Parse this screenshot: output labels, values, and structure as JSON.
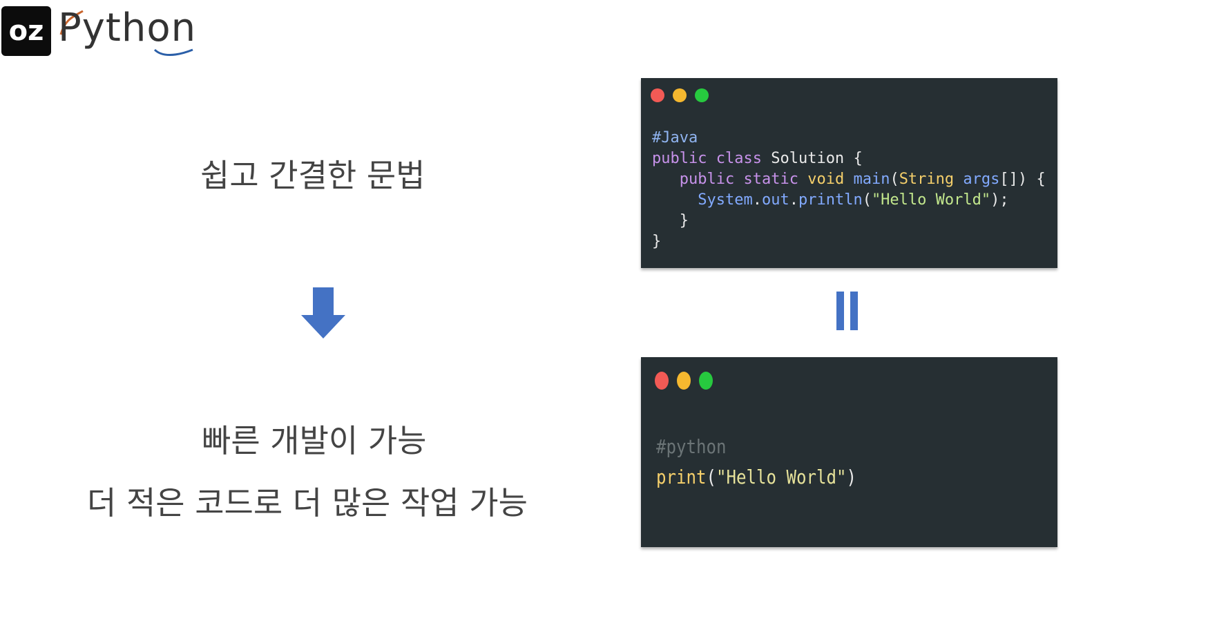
{
  "logo": {
    "badge": "oz",
    "word": "Python"
  },
  "headings": {
    "line1": "쉽고 간결한 문법",
    "line2": "빠른 개발이 가능",
    "line3": "더 적은 코드로 더 많은 작업 가능"
  },
  "java_window": {
    "comment": "#Java",
    "line1": {
      "kw1": "public",
      "kw2": "class",
      "name": "Solution",
      "open": "{"
    },
    "line2": {
      "kw1": "public",
      "kw2": "static",
      "kw3": "void",
      "method": "main",
      "p1": "(",
      "type": "String",
      "arg": "args",
      "rest": "[]) {"
    },
    "line3": {
      "obj": "System",
      "dot1": ".",
      "field": "out",
      "dot2": ".",
      "method": "println",
      "open": "(",
      "str": "\"Hello World\"",
      "close": ");"
    },
    "line4": "}",
    "line5": "}"
  },
  "python_window": {
    "comment": "#python",
    "fn": "print",
    "open": "(",
    "str": "\"Hello World\"",
    "close": ")"
  },
  "colors": {
    "window_bg": "#262f33",
    "dot_red": "#f25a55",
    "dot_yellow": "#f5b82f",
    "dot_green": "#27c93f",
    "accent_blue": "#4472c4"
  }
}
